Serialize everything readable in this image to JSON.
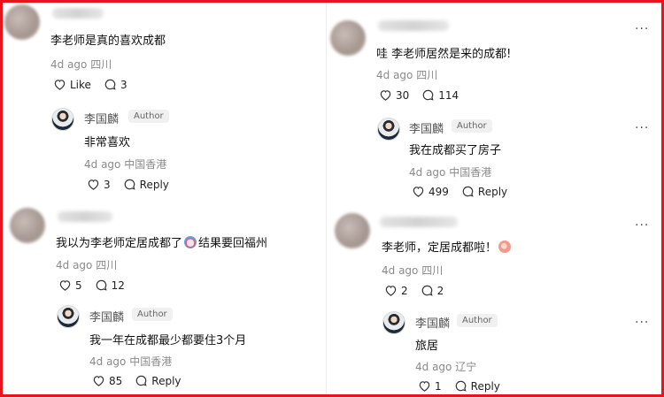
{
  "left": {
    "c1": {
      "text": "李老师是真的喜欢成都",
      "time": "4d ago",
      "loc": "四川",
      "like": "Like",
      "replies": "3"
    },
    "r1": {
      "name": "李国麟",
      "badge": "Author",
      "text": "非常喜欢",
      "time": "4d ago",
      "loc": "中国香港",
      "likes": "3",
      "reply": "Reply"
    },
    "c2": {
      "text_before": "我以为李老师定居成都了",
      "text_after": "结果要回福州",
      "emoji": "clown-face-icon",
      "time": "4d ago",
      "loc": "四川",
      "likes": "5",
      "replies": "12"
    },
    "r2": {
      "name": "李国麟",
      "badge": "Author",
      "text": "我一年在成都最少都要住3个月",
      "time": "4d ago",
      "loc": "中国香港",
      "likes": "85",
      "reply": "Reply"
    }
  },
  "right": {
    "c1": {
      "text": "哇 李老师居然是来的成都!",
      "time": "4d ago",
      "loc": "四川",
      "likes": "30",
      "replies": "114"
    },
    "r1": {
      "name": "李国麟",
      "badge": "Author",
      "text": "我在成都买了房子",
      "time": "4d ago",
      "loc": "中国香港",
      "likes": "499",
      "reply": "Reply"
    },
    "c2": {
      "text": "李老师，定居成都啦！",
      "emoji": "peach-heart-emoji-icon",
      "time": "4d ago",
      "loc": "四川",
      "likes": "2",
      "replies": "2"
    },
    "r2": {
      "name": "李国麟",
      "badge": "Author",
      "text": "旅居",
      "time": "4d ago",
      "loc": "辽宁",
      "likes": "1",
      "reply": "Reply"
    }
  },
  "colors": {
    "border": "#e8141b",
    "meta": "#8a8a8a"
  }
}
